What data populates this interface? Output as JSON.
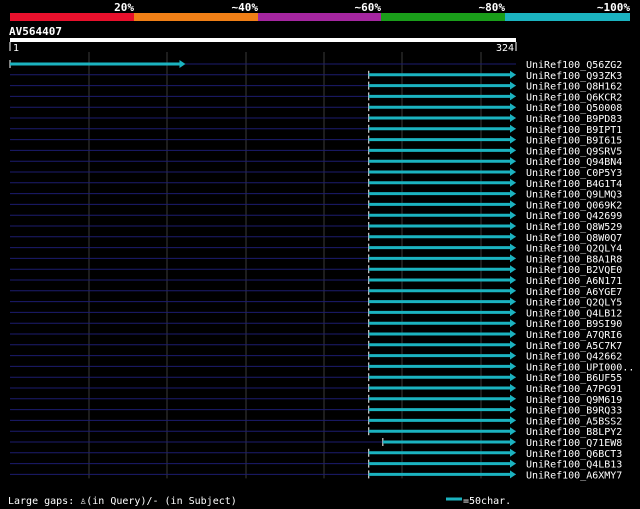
{
  "identity_scale": {
    "labels": [
      "20%",
      "~40%",
      "~60%",
      "~80%",
      "~100%"
    ],
    "colors": [
      "#e8102c",
      "#f07f16",
      "#a526a0",
      "#1a9e1a",
      "#1bb3c0"
    ]
  },
  "query": {
    "name": "AV564407",
    "start": 1,
    "end": 324,
    "start_label": "1",
    "end_label": "324"
  },
  "colors": {
    "background": "#000000",
    "hit": "#1bb3c0",
    "grid": "#444444",
    "track": "#1c1c6e",
    "text": "#ffffff"
  },
  "hits": [
    {
      "label": "UniRef100_Q56ZG2",
      "start": 1,
      "end": 113,
      "tail": "arrow"
    },
    {
      "label": "UniRef100_Q93ZK3",
      "start": 230,
      "end": 324,
      "tail": "arrow"
    },
    {
      "label": "UniRef100_Q8H162",
      "start": 230,
      "end": 324,
      "tail": "arrow"
    },
    {
      "label": "UniRef100_Q6KCR2",
      "start": 230,
      "end": 324,
      "tail": "arrow"
    },
    {
      "label": "UniRef100_Q50008",
      "start": 230,
      "end": 324,
      "tail": "arrow"
    },
    {
      "label": "UniRef100_B9PD83",
      "start": 230,
      "end": 324,
      "tail": "arrow"
    },
    {
      "label": "UniRef100_B9IPT1",
      "start": 230,
      "end": 324,
      "tail": "arrow"
    },
    {
      "label": "UniRef100_B9I615",
      "start": 230,
      "end": 324,
      "tail": "arrow"
    },
    {
      "label": "UniRef100_Q9SRV5",
      "start": 230,
      "end": 324,
      "tail": "arrow"
    },
    {
      "label": "UniRef100_Q94BN4",
      "start": 230,
      "end": 324,
      "tail": "arrow"
    },
    {
      "label": "UniRef100_C0P5Y3",
      "start": 230,
      "end": 324,
      "tail": "arrow"
    },
    {
      "label": "UniRef100_B4G1T4",
      "start": 230,
      "end": 324,
      "tail": "arrow"
    },
    {
      "label": "UniRef100_Q9LMQ3",
      "start": 230,
      "end": 324,
      "tail": "arrow"
    },
    {
      "label": "UniRef100_Q069K2",
      "start": 230,
      "end": 324,
      "tail": "arrow"
    },
    {
      "label": "UniRef100_Q42699",
      "start": 230,
      "end": 324,
      "tail": "arrow"
    },
    {
      "label": "UniRef100_Q8W529",
      "start": 230,
      "end": 324,
      "tail": "arrow"
    },
    {
      "label": "UniRef100_Q8W0Q7",
      "start": 230,
      "end": 324,
      "tail": "arrow"
    },
    {
      "label": "UniRef100_Q2QLY4",
      "start": 230,
      "end": 324,
      "tail": "arrow"
    },
    {
      "label": "UniRef100_B8A1R8",
      "start": 230,
      "end": 324,
      "tail": "arrow"
    },
    {
      "label": "UniRef100_B2VQE0",
      "start": 230,
      "end": 324,
      "tail": "arrow"
    },
    {
      "label": "UniRef100_A6N171",
      "start": 230,
      "end": 324,
      "tail": "arrow"
    },
    {
      "label": "UniRef100_A6YGE7",
      "start": 230,
      "end": 324,
      "tail": "arrow"
    },
    {
      "label": "UniRef100_Q2QLY5",
      "start": 230,
      "end": 324,
      "tail": "arrow"
    },
    {
      "label": "UniRef100_Q4LB12",
      "start": 230,
      "end": 324,
      "tail": "arrow"
    },
    {
      "label": "UniRef100_B9SI90",
      "start": 230,
      "end": 324,
      "tail": "arrow"
    },
    {
      "label": "UniRef100_A7QRI6",
      "start": 230,
      "end": 324,
      "tail": "arrow"
    },
    {
      "label": "UniRef100_A5C7K7",
      "start": 230,
      "end": 324,
      "tail": "arrow"
    },
    {
      "label": "UniRef100_Q42662",
      "start": 230,
      "end": 324,
      "tail": "arrow"
    },
    {
      "label": "UniRef100_UPI000..",
      "start": 230,
      "end": 324,
      "tail": "arrow"
    },
    {
      "label": "UniRef100_B6UF55",
      "start": 230,
      "end": 324,
      "tail": "arrow"
    },
    {
      "label": "UniRef100_A7PG91",
      "start": 230,
      "end": 324,
      "tail": "arrow"
    },
    {
      "label": "UniRef100_Q9M619",
      "start": 230,
      "end": 324,
      "tail": "arrow"
    },
    {
      "label": "UniRef100_B9RQ33",
      "start": 230,
      "end": 324,
      "tail": "arrow"
    },
    {
      "label": "UniRef100_A5BSS2",
      "start": 230,
      "end": 324,
      "tail": "arrow"
    },
    {
      "label": "UniRef100_B8LPY2",
      "start": 230,
      "end": 324,
      "tail": "arrow"
    },
    {
      "label": "UniRef100_Q71EW8",
      "start": 239,
      "end": 324,
      "tail": "arrow"
    },
    {
      "label": "UniRef100_Q6BCT3",
      "start": 230,
      "end": 324,
      "tail": "arrow"
    },
    {
      "label": "UniRef100_Q4LB13",
      "start": 230,
      "end": 324,
      "tail": "arrow"
    },
    {
      "label": "UniRef100_A6XMY7",
      "start": 230,
      "end": 324,
      "tail": "arrow"
    }
  ],
  "legend": {
    "gaps_text": "Large gaps: ♙(in Query)/- (in Subject)",
    "scale_text": "=50char."
  }
}
